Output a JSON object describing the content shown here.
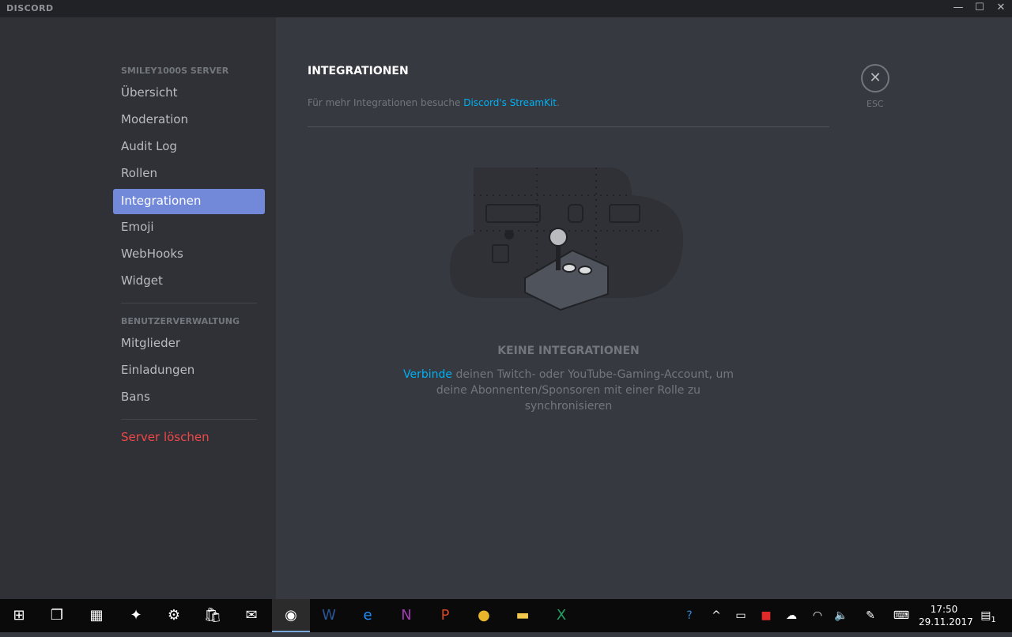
{
  "window": {
    "app_name": "DISCORD",
    "minimize": "—",
    "maximize": "☐",
    "close": "✕"
  },
  "sidebar": {
    "server_header": "SMILEY1000S SERVER",
    "items": [
      {
        "label": "Übersicht"
      },
      {
        "label": "Moderation"
      },
      {
        "label": "Audit Log"
      },
      {
        "label": "Rollen"
      },
      {
        "label": "Integrationen",
        "active": true
      },
      {
        "label": "Emoji"
      },
      {
        "label": "WebHooks"
      },
      {
        "label": "Widget"
      }
    ],
    "user_header": "BENUTZERVERWALTUNG",
    "user_items": [
      {
        "label": "Mitglieder"
      },
      {
        "label": "Einladungen"
      },
      {
        "label": "Bans"
      }
    ],
    "delete": "Server löschen"
  },
  "main": {
    "title": "INTEGRATIONEN",
    "subtitle_prefix": "Für mehr Integrationen besuche ",
    "subtitle_link": "Discord's StreamKit",
    "subtitle_suffix": ".",
    "close_label": "ESC",
    "empty_title": "KEINE INTEGRATIONEN",
    "empty_link": "Verbinde",
    "empty_text": " deinen Twitch- oder YouTube-Gaming-Account, um deine Abonnenten/Sponsoren mit einer Rolle zu synchronisieren"
  },
  "colors": {
    "accent": "#7289da",
    "link": "#00b0f4",
    "danger": "#f04747"
  },
  "taskbar": {
    "time": "17:50",
    "date": "29.11.2017",
    "notifications": "1",
    "apps": [
      "windows-start",
      "task-view",
      "calculator",
      "app",
      "settings",
      "store",
      "mail",
      "discord",
      "word",
      "edge",
      "onenote",
      "powerpoint",
      "chrome",
      "file-explorer",
      "excel"
    ]
  }
}
